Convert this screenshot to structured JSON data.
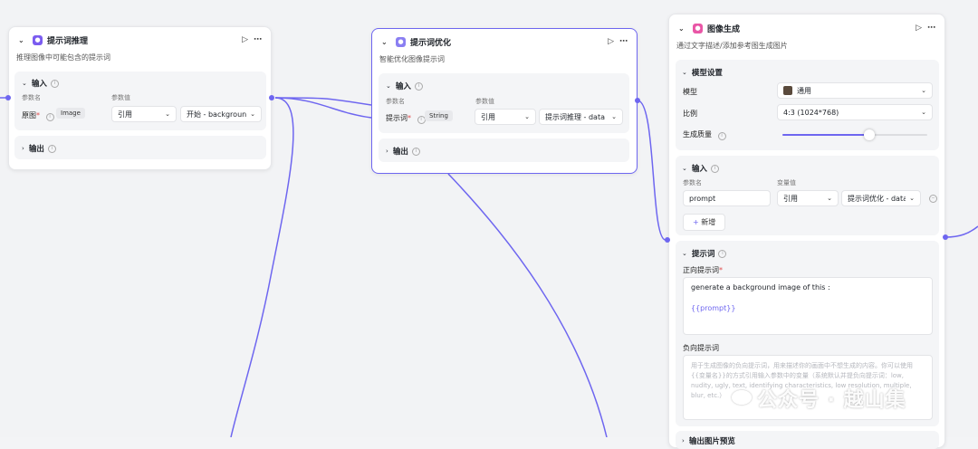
{
  "node1": {
    "title": "提示词推理",
    "desc": "推理图像中可能包含的提示词",
    "input_title": "输入",
    "col_param_name": "参数名",
    "col_param_value": "参数值",
    "param_label": "原图",
    "param_type": "Image",
    "ref_select": "引用",
    "value_select": "开始 - backgroun",
    "output_title": "输出"
  },
  "node2": {
    "title": "提示词优化",
    "desc": "智能优化图像提示词",
    "input_title": "输入",
    "col_param_name": "参数名",
    "col_param_value": "参数值",
    "param_label": "提示词",
    "param_type": "String",
    "ref_select": "引用",
    "value_select": "提示词推理 - data",
    "output_title": "输出"
  },
  "node3": {
    "title": "图像生成",
    "desc": "通过文字描述/添加参考图生成图片",
    "model_settings_title": "模型设置",
    "model_label": "模型",
    "model_value": "通用",
    "ratio_label": "比例",
    "ratio_value": "4:3 (1024*768)",
    "quality_label": "生成质量",
    "quality_level": 0.6,
    "input_title": "输入",
    "col_param_name": "参数名",
    "col_var_value": "变量值",
    "param_name": "prompt",
    "ref_select": "引用",
    "value_select": "提示词优化 - data",
    "add_label": "新增",
    "prompt_title": "提示词",
    "positive_label": "正向提示词",
    "positive_line1": "generate a background image of this :",
    "positive_line2": "{{prompt}}",
    "negative_label": "负向提示词",
    "negative_placeholder": "用于生成图像的负向提示词，用来描述你的画面中不想生成的内容。你可以使用{{变量名}}的方式引用输入参数中的变量（系统默认并提负向提示词：low, nudity, ugly, text, identifying characteristics, low resolution, multiple, blur, etc.）",
    "bottom_section": "输出图片预览"
  },
  "watermark": "公众号 · 越山集",
  "colors": {
    "accent": "#6e66f0",
    "node1_icon": "#7b5cf0",
    "node2_icon": "#8a7ff2",
    "node3_icon": "#e956a6"
  }
}
